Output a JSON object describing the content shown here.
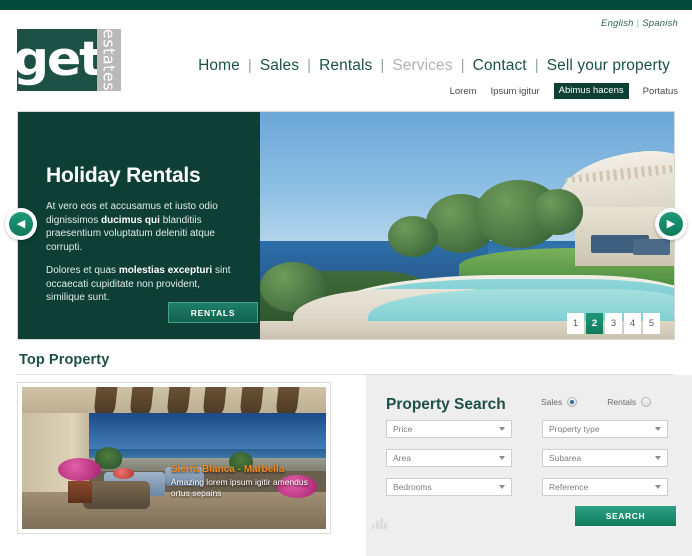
{
  "brand": {
    "logo_word": "get",
    "logo_sub": "estates"
  },
  "language": {
    "english": "English",
    "separator": "|",
    "spanish": "Spanish"
  },
  "mainnav": {
    "separator": "|",
    "items": [
      {
        "label": "Home",
        "muted": false
      },
      {
        "label": "Sales",
        "muted": false
      },
      {
        "label": "Rentals",
        "muted": false
      },
      {
        "label": "Services",
        "muted": true
      },
      {
        "label": "Contact",
        "muted": false
      },
      {
        "label": "Sell your property",
        "muted": false
      }
    ]
  },
  "subnav": {
    "items": [
      {
        "label": "Lorem",
        "active": false
      },
      {
        "label": "Ipsum igitur",
        "active": false
      },
      {
        "label": "Abimus hacens",
        "active": true
      },
      {
        "label": "Portatus",
        "active": false
      }
    ]
  },
  "hero": {
    "title": "Holiday Rentals",
    "paragraph1_a": "At vero eos et accusamus et iusto odio dignissimos ",
    "paragraph1_b": "ducimus qui",
    "paragraph1_c": " blanditiis praesentium voluptatum deleniti atque corrupti.",
    "paragraph2_a": "Dolores et quas ",
    "paragraph2_b": "molestias excepturi",
    "paragraph2_c": " sint occaecati cupiditate non provident, similique sunt.",
    "button_label": "RENTALS",
    "prev_icon": "chevron-left-icon",
    "next_icon": "chevron-right-icon",
    "pagination": [
      "1",
      "2",
      "3",
      "4",
      "5"
    ],
    "active_page": "2",
    "image_alt": "Luxury villa with infinity pool overlooking the sea"
  },
  "section": {
    "top_property_title": "Top Property"
  },
  "property_card": {
    "title": "Sierra Blanca - Marbella",
    "description": "Amazing lorem ipsum igitir amendus ortus sepains",
    "image_alt": "Covered terrace with wicker sofas and sea view"
  },
  "search": {
    "title": "Property Search",
    "mode_options": [
      {
        "label": "Sales",
        "selected": true
      },
      {
        "label": "Rentals",
        "selected": false
      }
    ],
    "fields": [
      {
        "label": "Price"
      },
      {
        "label": "Property type"
      },
      {
        "label": "Area"
      },
      {
        "label": "Subarea"
      },
      {
        "label": "Bedrooms"
      },
      {
        "label": "Reference"
      }
    ],
    "button_label": "SEARCH"
  },
  "colors": {
    "dark_green": "#034a3a",
    "panel_green": "#0d3f34",
    "logo_green": "#1d5146",
    "teal": "#12785c",
    "accent_orange": "#f08a1e",
    "panel_gray": "#eeeeee"
  }
}
